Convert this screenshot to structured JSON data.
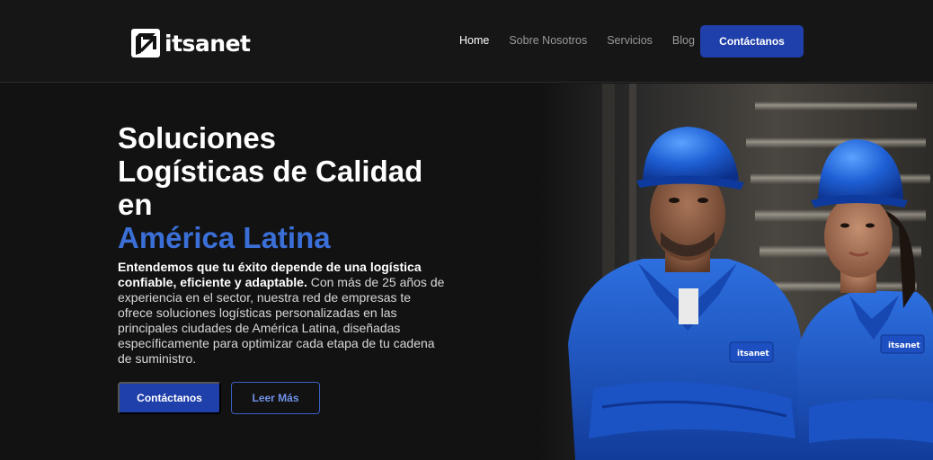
{
  "header": {
    "logo_text": "itsanet",
    "nav": [
      {
        "label": "Home"
      },
      {
        "label": "Sobre Nosotros"
      },
      {
        "label": "Servicios"
      },
      {
        "label": "Blog"
      }
    ],
    "cta_label": "Contáctanos"
  },
  "hero": {
    "title_lines": [
      "Soluciones",
      "Logísticas de Calidad",
      "en"
    ],
    "title_accent": "América Latina",
    "text_bold": "Entendemos que tu éxito depende de una logística confiable, eficiente y adaptable.",
    "text_rest": " Con más de 25 años de experiencia en el sector, nuestra red de empresas te ofrece soluciones logísticas personalizadas en las principales ciudades de América Latina, diseñadas específicamente para optimizar cada etapa de tu cadena de suministro.",
    "primary_button": "Contáctanos",
    "secondary_button": "Leer Más",
    "badge_text": "itsanet"
  },
  "colors": {
    "accent": "#1f3faa",
    "accent_text": "#3b6fd8",
    "background": "#121212"
  }
}
